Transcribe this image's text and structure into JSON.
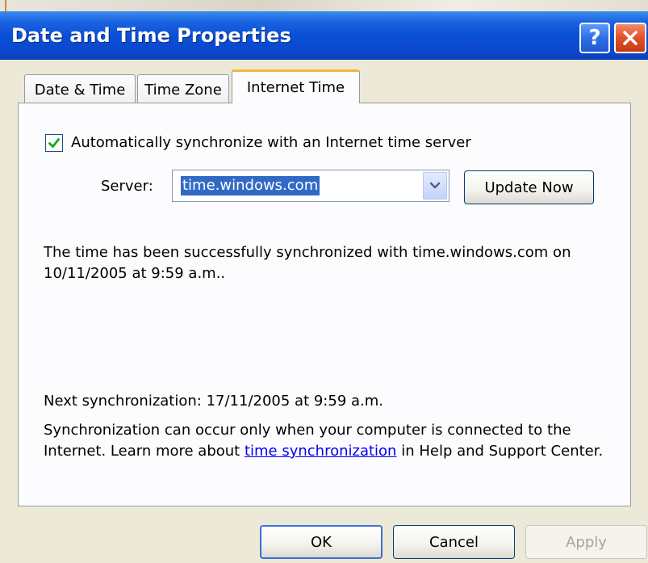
{
  "window": {
    "title": "Date and Time Properties",
    "help_glyph": "?",
    "close_glyph": "✕"
  },
  "tabs": [
    {
      "label": "Date & Time",
      "selected": false
    },
    {
      "label": "Time Zone",
      "selected": false
    },
    {
      "label": "Internet Time",
      "selected": true
    }
  ],
  "internet_time": {
    "auto_sync_label": "Automatically synchronize with an Internet time server",
    "auto_sync_checked": true,
    "server_label": "Server:",
    "server_value": "time.windows.com",
    "update_now_label": "Update Now",
    "status_text": "The time has been successfully synchronized with time.windows.com on 10/11/2005 at 9:59 a.m..",
    "next_sync_text": "Next synchronization: 17/11/2005 at 9:59 a.m.",
    "note_before_link": "Synchronization can occur only when your computer is connected to the Internet.  Learn more about ",
    "note_link": "time synchronization",
    "note_after_link": " in Help and Support Center."
  },
  "buttons": {
    "ok": "OK",
    "cancel": "Cancel",
    "apply": "Apply",
    "apply_enabled": false
  },
  "icons": {
    "checkbox": "checkmark-icon",
    "combo": "chevron-down-icon"
  },
  "colors": {
    "titlebar": "#0a4fd6",
    "close": "#e0502a",
    "selection": "#316ac5",
    "link": "#0000ee",
    "tab_highlight": "#f7b63e"
  }
}
